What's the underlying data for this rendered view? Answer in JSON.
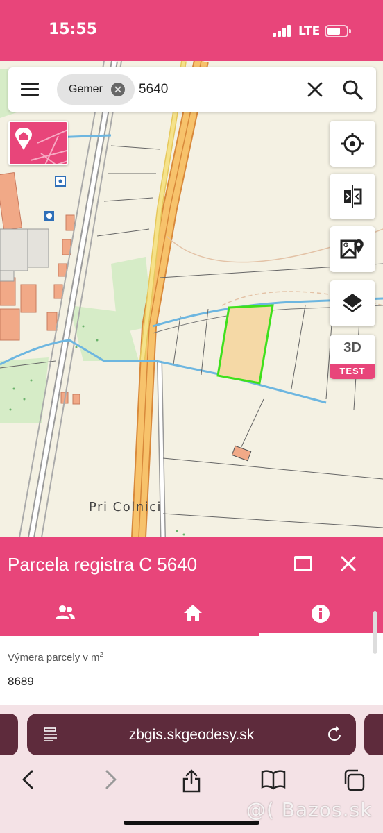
{
  "status_bar": {
    "time": "15:55",
    "network": "LTE",
    "battery_level": 0.6
  },
  "search": {
    "chip_label": "Gemer",
    "query": "5640"
  },
  "map": {
    "place_label": "Pri Colnici",
    "controls": {
      "locate_icon": "crosshair-icon",
      "compare_icon": "split-compare-icon",
      "google_maps_icon": "google-maps-icon",
      "layers_icon": "layers-icon",
      "mode_3d_label": "3D",
      "test_badge": "TEST"
    },
    "colors": {
      "parcel_outline": "#3fe01c",
      "parcel_fill": "#f5d9a6",
      "road_orange": "#f7c26b",
      "stream": "#6db6e0"
    }
  },
  "panel": {
    "title": "Parcela registra C 5640",
    "tabs": [
      {
        "icon": "owners-icon",
        "active": false
      },
      {
        "icon": "home-icon",
        "active": false
      },
      {
        "icon": "info-icon",
        "active": true
      }
    ],
    "field_label": "Výmera parcely v m",
    "field_label_sup": "2",
    "field_value": "8689"
  },
  "browser": {
    "url": "zbgis.skgeodesy.sk",
    "nav": [
      "back-icon",
      "forward-icon",
      "share-icon",
      "bookmarks-icon",
      "tabs-icon"
    ]
  },
  "watermark": "@( Bazos.sk",
  "theme": {
    "accent": "#e8457a",
    "browser_dark": "#5e2b3c"
  }
}
